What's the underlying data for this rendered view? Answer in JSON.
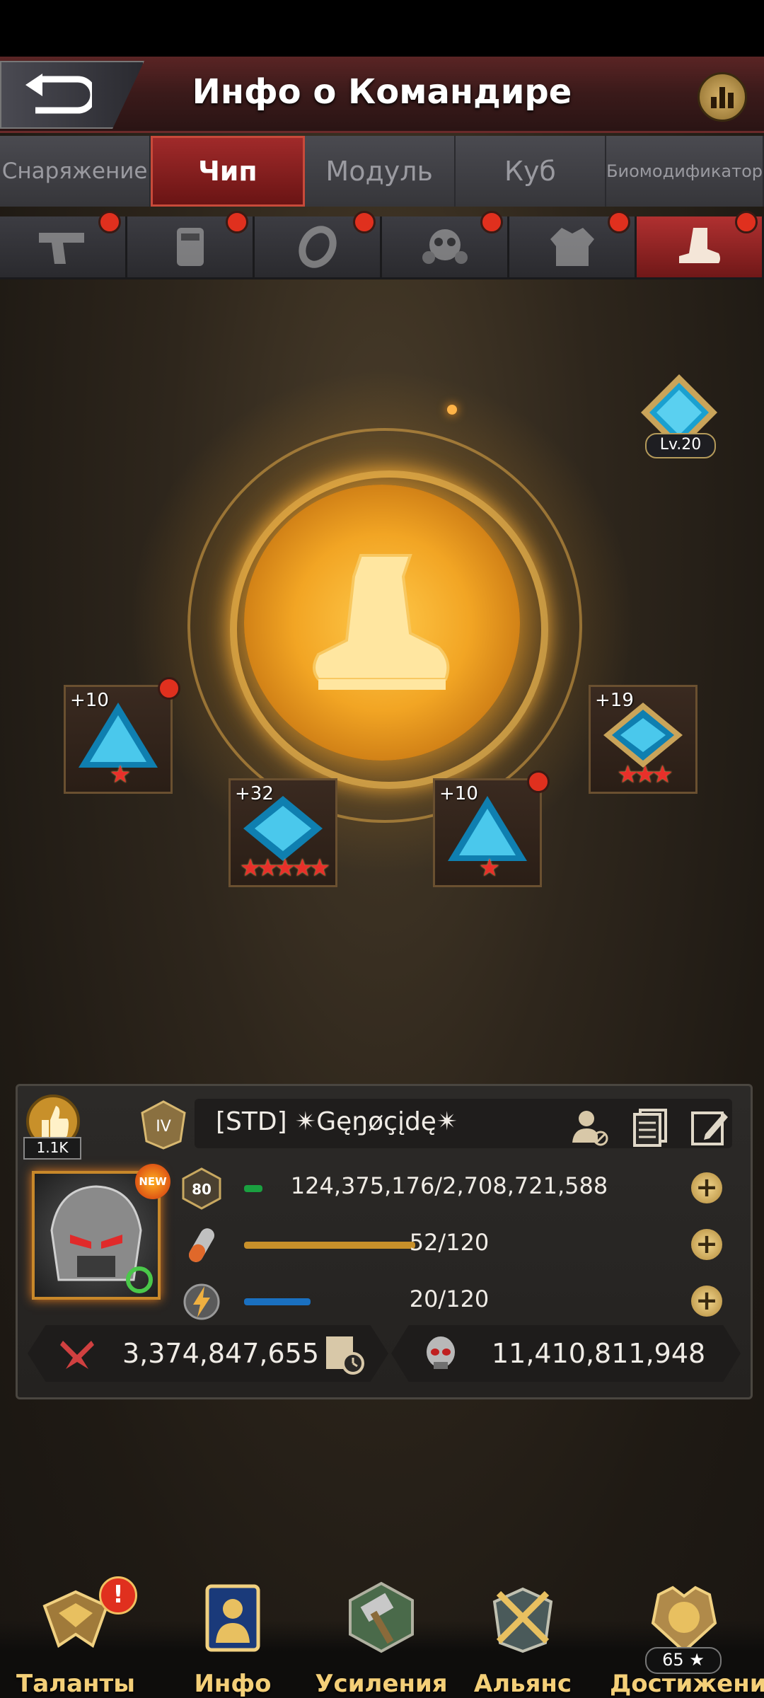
{
  "header": {
    "title": "Инфо о Командире"
  },
  "tabs": [
    {
      "label": "Снаряжение"
    },
    {
      "label": "Чип",
      "active": true
    },
    {
      "label": "Модуль"
    },
    {
      "label": "Куб"
    },
    {
      "label": "Биомодификатор"
    }
  ],
  "slots": [
    {
      "icon": "pistol-icon",
      "notify": true
    },
    {
      "icon": "armor-plate-icon",
      "notify": true
    },
    {
      "icon": "ring-icon",
      "notify": true
    },
    {
      "icon": "gas-mask-icon",
      "notify": true
    },
    {
      "icon": "jacket-icon",
      "notify": true
    },
    {
      "icon": "boot-icon",
      "notify": true,
      "active": true
    }
  ],
  "center": {
    "icon": "boot-icon",
    "level_label": "Lv.20"
  },
  "chips": [
    {
      "level": "+10",
      "stars": "★",
      "notify": true
    },
    {
      "level": "+32",
      "stars": "★★★★★",
      "notify": false
    },
    {
      "level": "+10",
      "stars": "★",
      "notify": true
    },
    {
      "level": "+19",
      "stars": "★★★",
      "notify": false
    }
  ],
  "profile": {
    "likes": "1.1K",
    "name": "[STD]  ✴Gęŋøçįdę✴",
    "rank": "IV",
    "new_badge": "NEW",
    "level": "80",
    "exp": {
      "text": "124,375,176/2,708,721,588",
      "fraction": 0.046
    },
    "stamina": {
      "text": "52/120",
      "fraction": 0.433
    },
    "energy": {
      "text": "20/120",
      "fraction": 0.167
    },
    "power": "3,374,847,655",
    "kills": "11,410,811,948",
    "plus": "+"
  },
  "nav": [
    {
      "label": "Таланты",
      "icon": "talents-icon",
      "alert": "!"
    },
    {
      "label": "Инфо",
      "icon": "info-icon",
      "active": true
    },
    {
      "label": "Усиления",
      "icon": "boosts-icon"
    },
    {
      "label": "Альянс",
      "icon": "alliance-icon"
    },
    {
      "label": "Достижение",
      "icon": "achievement-icon",
      "count": "65 ★"
    }
  ],
  "colors": {
    "accent": "#a02a2a",
    "gold": "#f4cf78",
    "notify": "#e0301e",
    "exp_bar": "#1aa040",
    "stamina_bar": "#c8902a",
    "energy_bar": "#1a70c0"
  }
}
